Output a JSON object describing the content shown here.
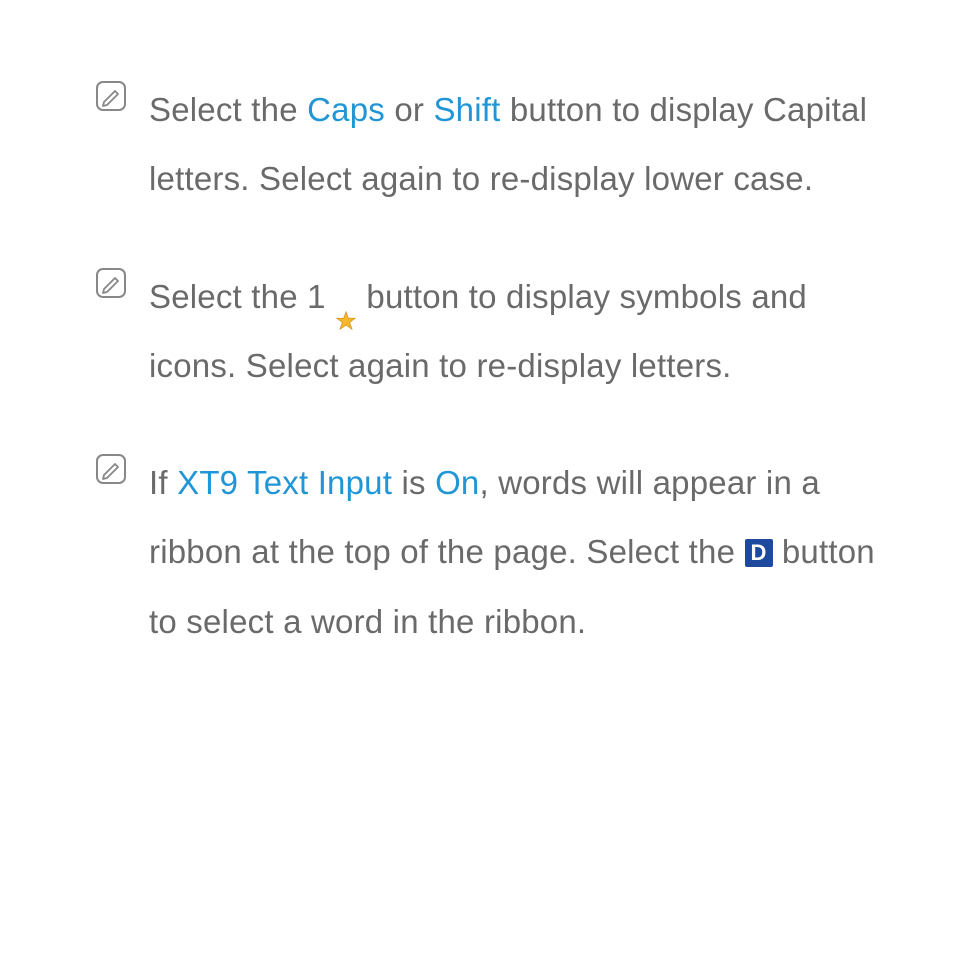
{
  "notes": [
    {
      "parts": [
        {
          "text": "Select the ",
          "type": "plain"
        },
        {
          "text": "Caps",
          "type": "highlight"
        },
        {
          "text": " or ",
          "type": "plain"
        },
        {
          "text": "Shift",
          "type": "highlight"
        },
        {
          "text": " button to display Capital letters. Select again to re-display lower case.",
          "type": "plain"
        }
      ]
    },
    {
      "parts": [
        {
          "text": "Select the 1 ",
          "type": "plain"
        },
        {
          "type": "star-icon"
        },
        {
          "text": " button to display symbols and icons. Select again to re-display letters.",
          "type": "plain"
        }
      ]
    },
    {
      "parts": [
        {
          "text": "If ",
          "type": "plain"
        },
        {
          "text": "XT9 Text Input",
          "type": "highlight"
        },
        {
          "text": " is ",
          "type": "plain"
        },
        {
          "text": "On",
          "type": "highlight"
        },
        {
          "text": ", words will appear in a ribbon at the top of the page. Select the ",
          "type": "plain"
        },
        {
          "type": "d-button",
          "text": "D"
        },
        {
          "text": " button to select a word in the ribbon.",
          "type": "plain"
        }
      ]
    }
  ]
}
